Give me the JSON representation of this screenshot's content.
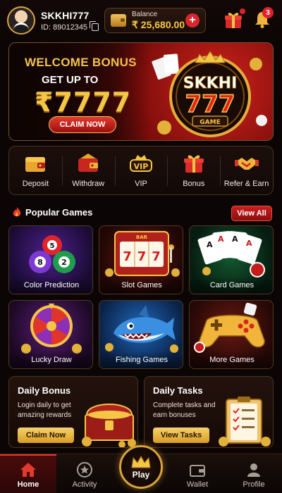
{
  "header": {
    "username": "SKKHI777",
    "user_id": "ID: 89012345",
    "balance_label": "Balance",
    "balance_value": "₹ 25,680.00",
    "add_symbol": "+",
    "notification_count": "3"
  },
  "banner": {
    "title": "WELCOME BONUS",
    "subtitle": "GET UP TO",
    "amount": "₹7777",
    "cta": "CLAIM NOW",
    "logo_top": "SKKHI",
    "logo_number": "777",
    "logo_bottom": "GAME"
  },
  "quick_actions": [
    {
      "label": "Deposit",
      "icon": "wallet-icon"
    },
    {
      "label": "Withdraw",
      "icon": "withdraw-wallet-icon"
    },
    {
      "label": "VIP",
      "icon": "vip-crown-icon"
    },
    {
      "label": "Bonus",
      "icon": "gift-icon"
    },
    {
      "label": "Refer & Earn",
      "icon": "handshake-icon"
    }
  ],
  "popular": {
    "title": "Popular Games",
    "view_all": "View All",
    "games": [
      {
        "label": "Color Prediction",
        "art": "lottery-balls"
      },
      {
        "label": "Slot Games",
        "art": "slot-machine"
      },
      {
        "label": "Card Games",
        "art": "playing-cards"
      },
      {
        "label": "Lucky Draw",
        "art": "prize-wheel"
      },
      {
        "label": "Fishing Games",
        "art": "shark"
      },
      {
        "label": "More Games",
        "art": "gamepad"
      }
    ],
    "ball_numbers": [
      "5",
      "8",
      "2"
    ],
    "slot_symbols": [
      "7",
      "7",
      "7"
    ],
    "slot_bar": "BAR",
    "card_ranks": [
      "A",
      "A",
      "A",
      "A"
    ]
  },
  "promos": {
    "daily_bonus": {
      "title": "Daily Bonus",
      "desc": "Login daily to get amazing rewards",
      "button": "Claim Now"
    },
    "daily_tasks": {
      "title": "Daily Tasks",
      "desc": "Complete tasks and earn bonuses",
      "button": "View Tasks"
    }
  },
  "nav": {
    "items": [
      {
        "label": "Home",
        "icon": "home-icon",
        "active": true
      },
      {
        "label": "Activity",
        "icon": "activity-star-icon",
        "active": false
      },
      {
        "label": "Wallet",
        "icon": "wallet-icon",
        "active": false
      },
      {
        "label": "Profile",
        "icon": "profile-icon",
        "active": false
      }
    ],
    "play_label": "Play"
  },
  "colors": {
    "gold": "#f4c646",
    "accent_red": "#d9262f",
    "background": "#0b0605"
  }
}
